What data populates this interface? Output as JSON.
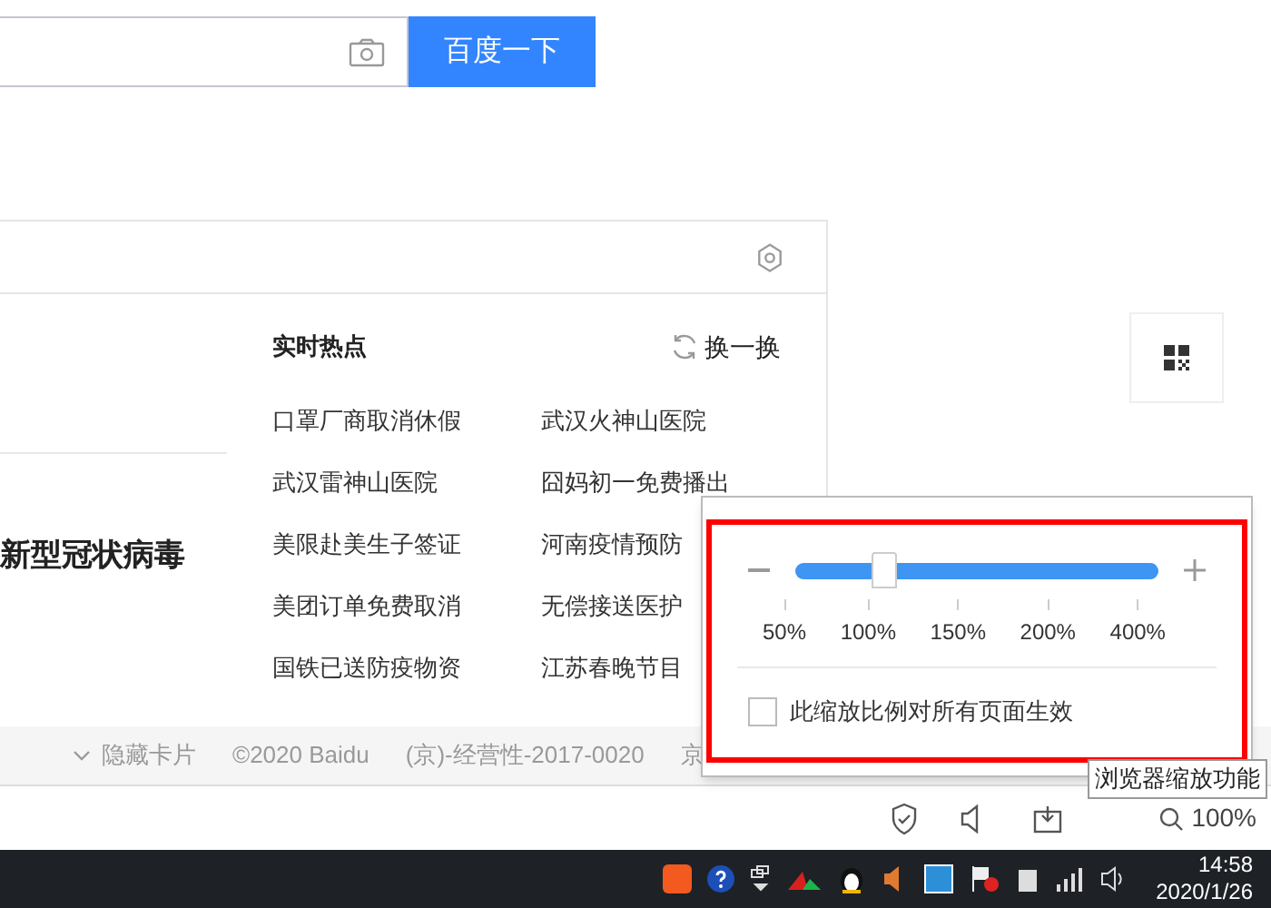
{
  "search": {
    "button": "百度一下"
  },
  "card": {
    "headline": "新型冠状病毒",
    "hot": {
      "title": "实时热点",
      "refresh": "换一换",
      "rows": [
        [
          "口罩厂商取消休假",
          "武汉火神山医院"
        ],
        [
          "武汉雷神山医院",
          "囧妈初一免费播出"
        ],
        [
          "美限赴美生子签证",
          "河南疫情预防"
        ],
        [
          "美团订单免费取消",
          "无偿接送医护"
        ],
        [
          "国铁已送防疫物资",
          "江苏春晚节目"
        ]
      ]
    }
  },
  "footer": {
    "hide": "隐藏卡片",
    "copyright": "©2020 Baidu",
    "license": "(京)-经营性-2017-0020",
    "extra": "京"
  },
  "zoom_popup": {
    "level": 0.245,
    "ticks": [
      "50%",
      "100%",
      "150%",
      "200%",
      "400%"
    ],
    "apply_all": {
      "label": "此缩放比例对所有页面生效",
      "checked": false
    }
  },
  "tooltip": "浏览器缩放功能",
  "status_bar": {
    "zoom": "100%"
  },
  "taskbar": {
    "time": "14:58",
    "date": "2020/1/26"
  }
}
